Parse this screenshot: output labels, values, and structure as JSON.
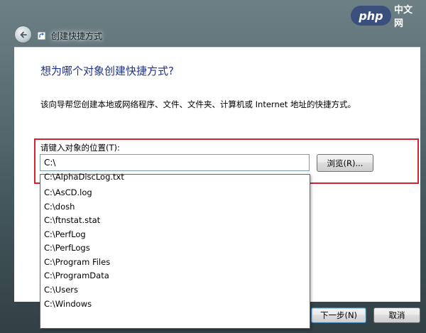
{
  "window": {
    "title": "创建快捷方式",
    "watermark_logo": "php",
    "watermark_sub": "中文网"
  },
  "content": {
    "heading": "想为哪个对象创建快捷方式?",
    "description": "该向导帮您创建本地或网络程序、文件、文件夹、计算机或 Internet 地址的快捷方式。",
    "field_label": "请键入对象的位置(T):",
    "location_value": "C:\\",
    "browse_label": "浏览(R)..."
  },
  "autocomplete": {
    "items": [
      "C:\\AlphaDiscLog.txt",
      "C:\\AsCD.log",
      "C:\\dosh",
      "C:\\ftnstat.stat",
      "C:\\PerfLog",
      "C:\\PerfLogs",
      "C:\\Program Files",
      "C:\\ProgramData",
      "C:\\Users",
      "C:\\Windows"
    ]
  },
  "footer": {
    "next_label": "下一步(N)",
    "cancel_label": "取消"
  },
  "colors": {
    "heading": "#1e3287",
    "highlight_border": "#d8202e",
    "input_border": "#7a9cb5"
  },
  "icons": {
    "back": "back-arrow-icon",
    "title": "shortcut-icon"
  }
}
